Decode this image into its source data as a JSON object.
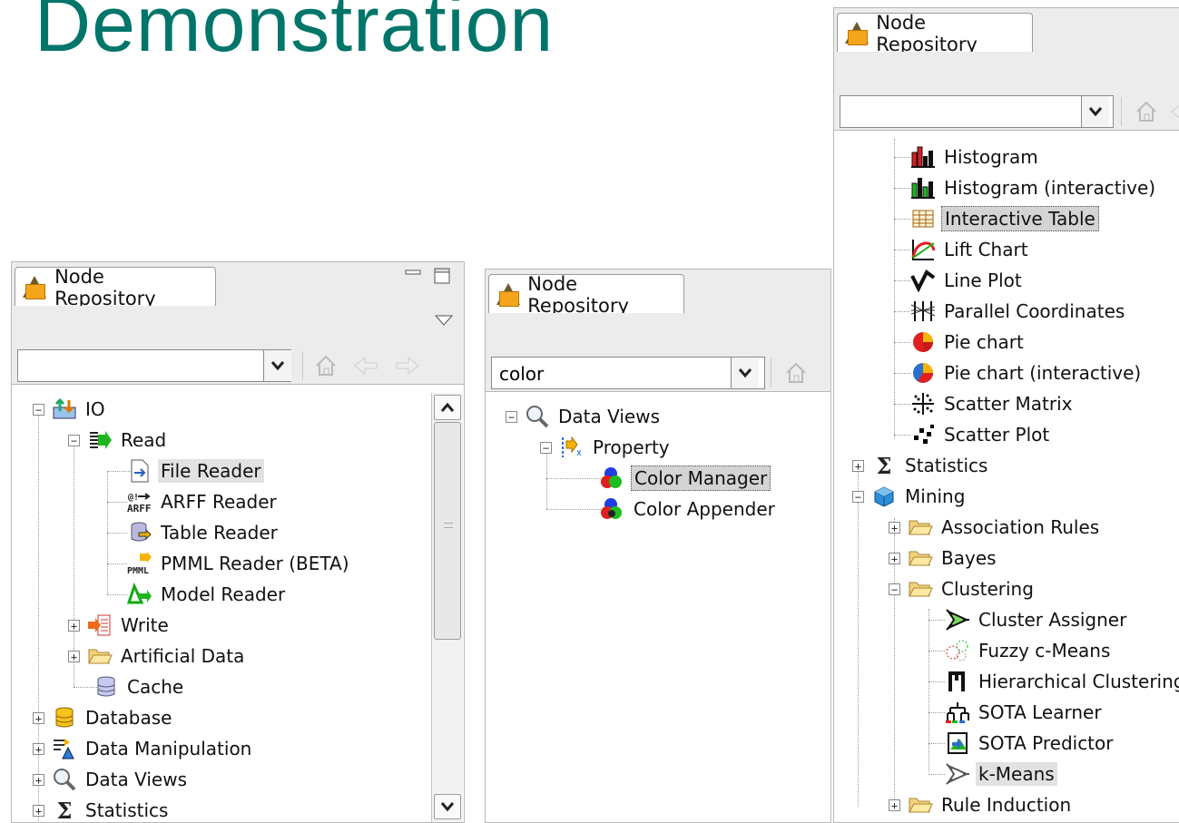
{
  "slide": {
    "title": "Demonstration"
  },
  "panels": {
    "left": {
      "tab_label": "Node Repository",
      "search_value": "",
      "tree": [
        {
          "label": "IO",
          "icon": "io-icon",
          "expander": "minus"
        },
        {
          "label": "Read",
          "icon": "read-icon",
          "expander": "minus"
        },
        {
          "label": "File Reader",
          "icon": "file-reader-icon",
          "state": "highlighted"
        },
        {
          "label": "ARFF Reader",
          "icon": "arff-reader-icon"
        },
        {
          "label": "Table Reader",
          "icon": "table-reader-icon"
        },
        {
          "label": "PMML Reader (BETA)",
          "icon": "pmml-reader-icon"
        },
        {
          "label": "Model Reader",
          "icon": "model-reader-icon"
        },
        {
          "label": "Write",
          "icon": "write-icon",
          "expander": "plus"
        },
        {
          "label": "Artificial Data",
          "icon": "folder-icon",
          "expander": "plus"
        },
        {
          "label": "Cache",
          "icon": "cache-icon"
        },
        {
          "label": "Database",
          "icon": "database-icon",
          "expander": "plus"
        },
        {
          "label": "Data Manipulation",
          "icon": "data-manipulation-icon",
          "expander": "plus"
        },
        {
          "label": "Data Views",
          "icon": "magnifier-icon",
          "expander": "plus"
        },
        {
          "label": "Statistics",
          "icon": "sigma-icon",
          "expander": "plus"
        }
      ]
    },
    "middle": {
      "tab_label": "Node Repository",
      "search_value": "color",
      "tree": [
        {
          "label": "Data Views",
          "icon": "magnifier-icon",
          "expander": "minus"
        },
        {
          "label": "Property",
          "icon": "property-icon",
          "expander": "minus"
        },
        {
          "label": "Color Manager",
          "icon": "color-manager-icon",
          "state": "selected"
        },
        {
          "label": "Color Appender",
          "icon": "color-appender-icon"
        }
      ]
    },
    "right": {
      "tab_label": "Node Repository",
      "search_value": "",
      "tree": [
        {
          "label": "Histogram",
          "icon": "histogram-icon"
        },
        {
          "label": "Histogram (interactive)",
          "icon": "histogram-interactive-icon"
        },
        {
          "label": "Interactive Table",
          "icon": "table-icon",
          "state": "selected"
        },
        {
          "label": "Lift Chart",
          "icon": "lift-chart-icon"
        },
        {
          "label": "Line Plot",
          "icon": "line-plot-icon"
        },
        {
          "label": "Parallel Coordinates",
          "icon": "parallel-coordinates-icon"
        },
        {
          "label": "Pie chart",
          "icon": "pie-chart-icon"
        },
        {
          "label": "Pie chart (interactive)",
          "icon": "pie-chart-interactive-icon"
        },
        {
          "label": "Scatter Matrix",
          "icon": "scatter-matrix-icon"
        },
        {
          "label": "Scatter Plot",
          "icon": "scatter-plot-icon"
        },
        {
          "label": "Statistics",
          "icon": "sigma-icon",
          "expander": "plus"
        },
        {
          "label": "Mining",
          "icon": "mining-icon",
          "expander": "minus"
        },
        {
          "label": "Association Rules",
          "icon": "folder-icon",
          "expander": "plus"
        },
        {
          "label": "Bayes",
          "icon": "folder-icon",
          "expander": "plus"
        },
        {
          "label": "Clustering",
          "icon": "folder-icon",
          "expander": "minus"
        },
        {
          "label": "Cluster Assigner",
          "icon": "cluster-assigner-icon"
        },
        {
          "label": "Fuzzy c-Means",
          "icon": "fuzzy-c-means-icon"
        },
        {
          "label": "Hierarchical Clustering",
          "icon": "hierarchical-clustering-icon"
        },
        {
          "label": "SOTA Learner",
          "icon": "sota-learner-icon"
        },
        {
          "label": "SOTA Predictor",
          "icon": "sota-predictor-icon"
        },
        {
          "label": "k-Means",
          "icon": "k-means-icon",
          "state": "highlighted"
        },
        {
          "label": "Rule Induction",
          "icon": "folder-icon",
          "expander": "plus"
        }
      ]
    }
  }
}
